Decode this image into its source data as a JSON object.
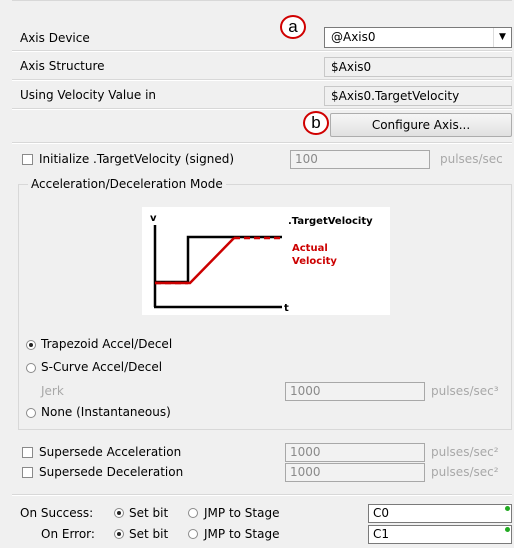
{
  "callouts": {
    "a": "a",
    "b": "b"
  },
  "axis": {
    "device_label": "Axis Device",
    "device_value": "@Axis0",
    "structure_label": "Axis Structure",
    "structure_value": "$Axis0",
    "velocity_label": "Using Velocity Value in",
    "velocity_value": "$Axis0.TargetVelocity",
    "configure_button": "Configure Axis..."
  },
  "init_velocity": {
    "label": "Initialize .TargetVelocity (signed)",
    "value": "100",
    "unit": "pulses/sec",
    "checked": false
  },
  "accel_group": {
    "title": "Acceleration/Deceleration Mode",
    "diagram": {
      "v_label": "v",
      "t_label": "t",
      "target_label": ".TargetVelocity",
      "actual_label_1": "Actual",
      "actual_label_2": "Velocity",
      "actual_color": "#cc0000"
    },
    "options": {
      "trapezoid": "Trapezoid Accel/Decel",
      "scurve": "S-Curve  Accel/Decel",
      "none": "None (Instantaneous)"
    },
    "selected": "trapezoid",
    "jerk_label": "Jerk",
    "jerk_value": "1000",
    "jerk_unit": "pulses/sec³"
  },
  "supersede": {
    "accel_label": "Supersede Acceleration",
    "accel_value": "1000",
    "accel_unit": "pulses/sec²",
    "decel_label": "Supersede Deceleration",
    "decel_value": "1000",
    "decel_unit": "pulses/sec²"
  },
  "on_success": {
    "label": "On Success:",
    "set_bit": "Set bit",
    "jmp": "JMP to Stage",
    "value": "C0"
  },
  "on_error": {
    "label": "On Error:",
    "set_bit": "Set bit",
    "jmp": "JMP to Stage",
    "value": "C1"
  },
  "status_color": "#22aa22"
}
